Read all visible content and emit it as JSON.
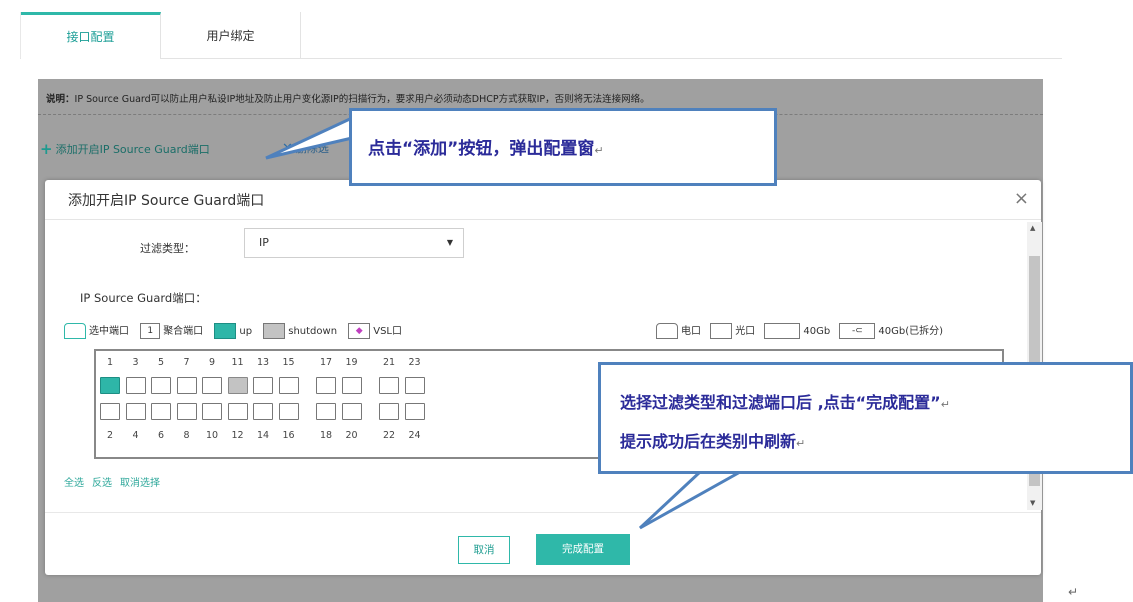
{
  "tabs": [
    {
      "label": "接口配置",
      "active": true
    },
    {
      "label": "用户绑定",
      "active": false
    }
  ],
  "description": {
    "prefix": "说明：",
    "text": "IP Source Guard可以防止用户私设IP地址及防止用户变化源IP的扫描行为，要求用户必须动态DHCP方式获取IP，否则将无法连接网络。"
  },
  "actions": {
    "add_label": "添加开启IP Source Guard端口",
    "delete_label": "删除选"
  },
  "callouts": {
    "top": "点击“添加”按钮，弹出配置窗",
    "bottom_line1": "选择过滤类型和过滤端口后 ,点击“完成配置”",
    "bottom_line2": "提示成功后在类别中刷新",
    "return_mark": "↵"
  },
  "modal": {
    "title": "添加开启IP Source Guard端口",
    "close_glyph": "×",
    "filter_type_label": "过滤类型：",
    "filter_type_value": "IP",
    "ports_label": "IP Source Guard端口：",
    "legend": {
      "selected": "选中端口",
      "aggregate_num": "1",
      "aggregate": "聚合端口",
      "up": "up",
      "shutdown": "shutdown",
      "vsl": "VSL口",
      "electric": "电口",
      "optical": "光口",
      "g40": "40Gb",
      "g40_split": "40Gb(已拆分)"
    },
    "port_numbers_top": [
      "1",
      "3",
      "5",
      "7",
      "9",
      "11",
      "13",
      "15",
      "17",
      "19",
      "21",
      "23"
    ],
    "port_numbers_bottom": [
      "2",
      "4",
      "6",
      "8",
      "10",
      "12",
      "14",
      "16",
      "18",
      "20",
      "22",
      "24"
    ],
    "port_states": {
      "1": "up",
      "11": "down"
    },
    "selectors": {
      "all": "全选",
      "invert": "反选",
      "cancel": "取消选择"
    },
    "cancel_button": "取消",
    "ok_button": "完成配置"
  },
  "colors": {
    "accent": "#2fb8a9",
    "callout_border": "#4f81bd",
    "callout_text": "#2b2b99"
  }
}
